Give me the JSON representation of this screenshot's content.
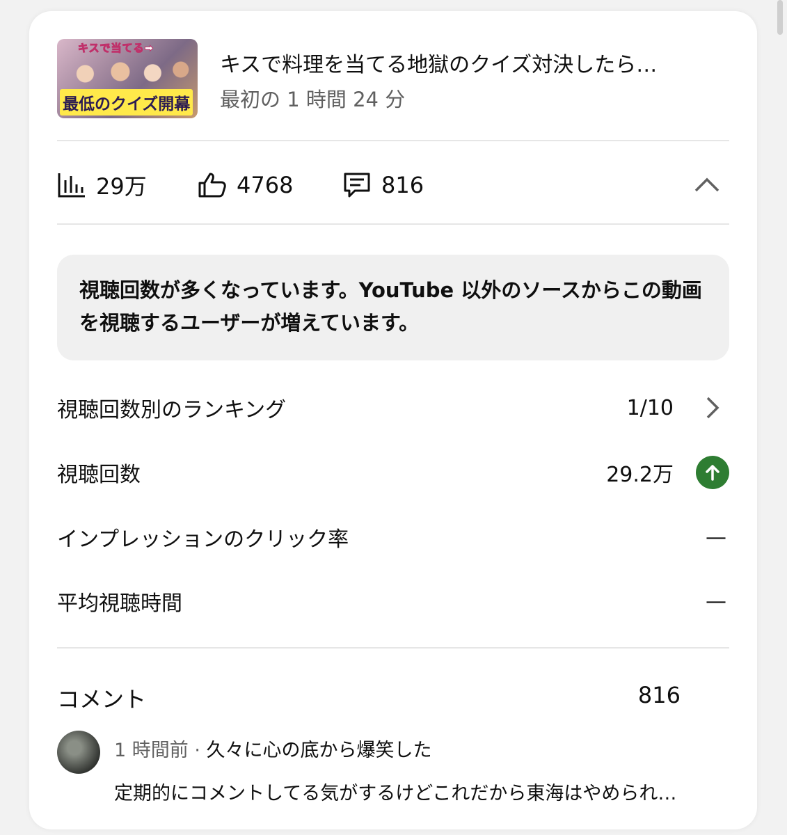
{
  "video": {
    "thumbnail_top_text": "キスで当てる➡",
    "thumbnail_bottom_text": "最低のクイズ開幕",
    "title": "キスで料理を当てる地獄のクイズ対決したら…",
    "subtitle": "最初の 1 時間 24 分"
  },
  "stats": {
    "views": "29万",
    "likes": "4768",
    "comments": "816"
  },
  "notice": {
    "text": "視聴回数が多くなっています。YouTube 以外のソースからこの動画を視聴するユーザーが増えています。"
  },
  "metrics": {
    "ranking_label": "視聴回数別のランキング",
    "ranking_value": "1/10",
    "views_label": "視聴回数",
    "views_value": "29.2万",
    "ctr_label": "インプレッションのクリック率",
    "ctr_value": "—",
    "avg_label": "平均視聴時間",
    "avg_value": "—"
  },
  "comments_section": {
    "label": "コメント",
    "count": "816",
    "latest": {
      "time": "1 時間前",
      "separator": " · ",
      "reply": "久々に心の底から爆笑した",
      "text": "定期的にコメントしてる気がするけどこれだから東海はやめられ…"
    }
  },
  "colors": {
    "accent_green": "#2e7d32",
    "secondary_text": "#606060"
  }
}
